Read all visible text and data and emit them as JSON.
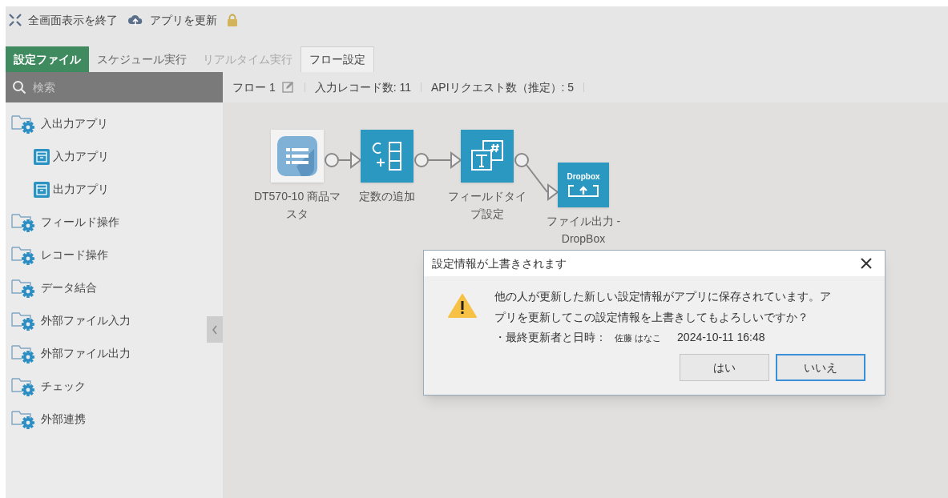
{
  "toolbar": [
    {
      "kind": "exit-fullscreen",
      "label": "全画面表示を終了"
    },
    {
      "kind": "update",
      "label": "アプリを更新"
    },
    {
      "kind": "lock"
    }
  ],
  "tabs": [
    {
      "label": "設定ファイル",
      "kind": "file",
      "selected": false,
      "disabled": false
    },
    {
      "label": "スケジュール実行",
      "kind": "tab",
      "selected": false,
      "disabled": false
    },
    {
      "label": "リアルタイム実行",
      "kind": "tab",
      "selected": false,
      "disabled": true
    },
    {
      "label": "フロー設定",
      "kind": "tab",
      "selected": true,
      "disabled": false
    }
  ],
  "sidebar": {
    "search": {
      "placeholder": "検索"
    },
    "items": [
      {
        "label": "入出力アプリ",
        "kind": "folder",
        "children": [
          {
            "label": "入力アプリ",
            "kind": "app"
          },
          {
            "label": "出力アプリ",
            "kind": "app"
          }
        ]
      },
      {
        "label": "フィールド操作",
        "kind": "folder"
      },
      {
        "label": "レコード操作",
        "kind": "folder"
      },
      {
        "label": "データ結合",
        "kind": "folder"
      },
      {
        "label": "外部ファイル入力",
        "kind": "folder"
      },
      {
        "label": "外部ファイル出力",
        "kind": "folder"
      },
      {
        "label": "チェック",
        "kind": "folder"
      },
      {
        "label": "外部連携",
        "kind": "folder"
      }
    ]
  },
  "flow_header": {
    "name": "フロー 1",
    "records": "入力レコード数: 11",
    "api_requests": "APIリクエスト数（推定）: 5"
  },
  "flow": {
    "nodes": [
      {
        "kind": "table",
        "label": "DT570-10 商品マスタ"
      },
      {
        "kind": "constant",
        "label": "定数の追加"
      },
      {
        "kind": "fieldtype",
        "label": "フィールドタイプ設定"
      },
      {
        "kind": "dropbox",
        "badge": "Dropbox",
        "label": "ファイル出力 -",
        "label_2": "DropBox"
      }
    ]
  },
  "dialog": {
    "title": "設定情報が上書きされます",
    "message": "他の人が更新した新しい設定情報がアプリに保存されています。アプリを更新してこの設定情報を上書きしてもよろしいですか？",
    "detail_label": "・最終更新者と日時：",
    "user": "佐藤 はなこ",
    "datetime": "2024-10-11 16:48",
    "buttons": [
      {
        "label": "はい",
        "focused": false
      },
      {
        "label": "いいえ",
        "focused": true
      }
    ]
  }
}
